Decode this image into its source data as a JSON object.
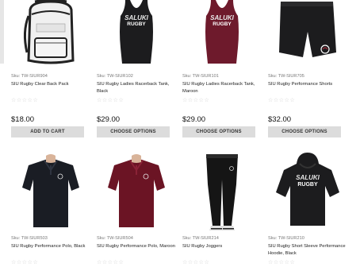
{
  "products": [
    {
      "sku": "Sku: TW-SIUR904",
      "name": "SIU Rugby Clear Back Pack",
      "rating": "☆☆☆☆☆",
      "price": "$18.00",
      "button": "ADD TO CART",
      "print_top": "",
      "print_bottom": ""
    },
    {
      "sku": "Sku: TW-SIUR102",
      "name": "SIU Rugby Ladies Racerback Tank, Black",
      "rating": "☆☆☆☆☆",
      "price": "$29.00",
      "button": "CHOOSE OPTIONS",
      "print_top": "SALUKI",
      "print_bottom": "RUGBY"
    },
    {
      "sku": "Sku: TW-SIUR101",
      "name": "SIU Rugby Ladies Racerback Tank, Maroon",
      "rating": "☆☆☆☆☆",
      "price": "$29.00",
      "button": "CHOOSE OPTIONS",
      "print_top": "SALUKI",
      "print_bottom": "RUGBY"
    },
    {
      "sku": "Sku: TW-SIUR705",
      "name": "SIU Rugby Performance Shorts",
      "rating": "☆☆☆☆☆",
      "price": "$32.00",
      "button": "CHOOSE OPTIONS",
      "print_top": "",
      "print_bottom": ""
    },
    {
      "sku": "Sku: TW-SIUR503",
      "name": "SIU Rugby Performance Polo, Black",
      "rating": "☆☆☆☆☆",
      "price": "",
      "button": "",
      "print_top": "",
      "print_bottom": ""
    },
    {
      "sku": "Sku: TW-SIUR504",
      "name": "SIU Rugby Performance Polo, Maroon",
      "rating": "☆☆☆☆☆",
      "price": "",
      "button": "",
      "print_top": "",
      "print_bottom": ""
    },
    {
      "sku": "Sku: TW-SIUR214",
      "name": "SIU Rugby Joggers",
      "rating": "☆☆☆☆☆",
      "price": "",
      "button": "",
      "print_top": "",
      "print_bottom": ""
    },
    {
      "sku": "Sku: TW-SIUR210",
      "name": "SIU Rugby Short Sleeve Performance Hoodie, Black",
      "rating": "☆☆☆☆☆",
      "price": "",
      "button": "",
      "print_top": "SALUKI",
      "print_bottom": "RUGBY"
    }
  ],
  "colors": {
    "black": "#1c1c1e",
    "maroon": "#6e1a2c",
    "button_bg": "#dcdcdc"
  }
}
